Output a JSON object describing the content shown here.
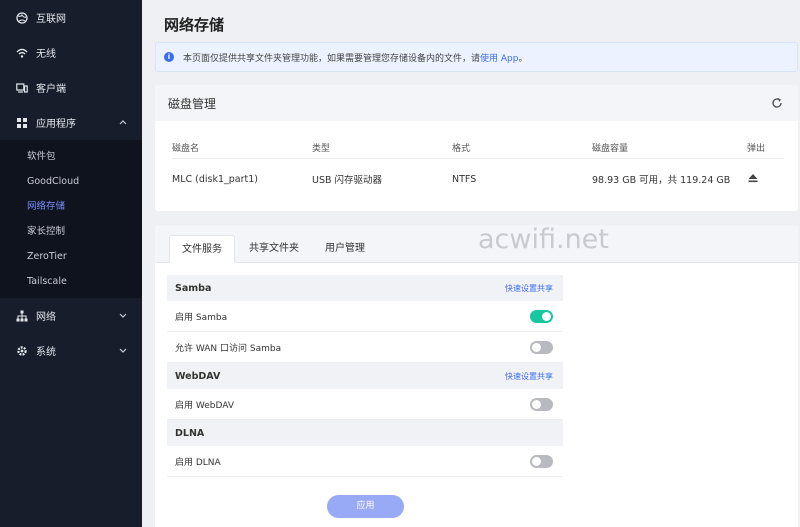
{
  "sidebar": {
    "top_items": [
      {
        "label": "互联网",
        "icon": "globe-icon"
      },
      {
        "label": "无线",
        "icon": "wifi-icon"
      },
      {
        "label": "客户端",
        "icon": "devices-icon"
      },
      {
        "label": "应用程序",
        "icon": "apps-icon"
      }
    ],
    "sub_items": [
      "软件包",
      "GoodCloud",
      "网络存储",
      "家长控制",
      "ZeroTier",
      "Tailscale"
    ],
    "active_sub": "网络存储",
    "bottom_items": [
      {
        "label": "网络",
        "icon": "network-icon"
      },
      {
        "label": "系统",
        "icon": "gear-icon"
      }
    ]
  },
  "page": {
    "title": "网络存储"
  },
  "notice": {
    "text": "本页面仅提供共享文件夹管理功能，如果需要管理您存储设备内的文件，请",
    "link": "使用 App",
    "suffix": "。"
  },
  "disk": {
    "title": "磁盘管理",
    "columns": [
      "磁盘名",
      "类型",
      "格式",
      "磁盘容量",
      "弹出"
    ],
    "rows": [
      {
        "name": "MLC (disk1_part1)",
        "type": "USB 闪存驱动器",
        "format": "NTFS",
        "capacity": "98.93 GB 可用，共 119.24 GB"
      }
    ]
  },
  "tabs": [
    "文件服务",
    "共享文件夹",
    "用户管理"
  ],
  "services": {
    "samba": {
      "title": "Samba",
      "quick": "快速设置共享",
      "rows": [
        {
          "label": "启用 Samba",
          "on": true
        },
        {
          "label": "允许 WAN 口访问 Samba",
          "on": false
        }
      ]
    },
    "webdav": {
      "title": "WebDAV",
      "quick": "快速设置共享",
      "rows": [
        {
          "label": "启用 WebDAV",
          "on": false
        }
      ]
    },
    "dlna": {
      "title": "DLNA",
      "rows": [
        {
          "label": "启用 DLNA",
          "on": false
        }
      ]
    }
  },
  "apply_label": "应用",
  "watermark": "acwifi.net",
  "colors": {
    "sidebar_bg": "#171d2b",
    "accent": "#3b6df0",
    "toggle_on": "#18c6a0",
    "active_nav": "#7a8cff"
  }
}
